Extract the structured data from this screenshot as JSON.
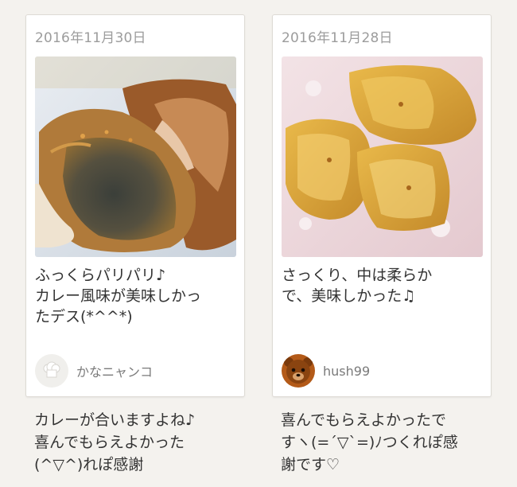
{
  "cards": [
    {
      "date": "2016年11月30日",
      "comment_lines": [
        "ふっくらパリパリ♪",
        "カレー風味が美味しかっ",
        "たデス(*^^*)"
      ],
      "user": {
        "name": "かなニャンコ",
        "avatar": "default-chef-hat-icon"
      },
      "reply_lines": [
        "カレーが合いますよね♪",
        "喜んでもらえよかった",
        "(^▽^)れぽ感謝"
      ]
    },
    {
      "date": "2016年11月28日",
      "comment_lines": [
        "さっくり、中は柔らか",
        "で、美味しかった♫"
      ],
      "user": {
        "name": "hush99",
        "avatar": "bear-avatar-icon"
      },
      "reply_lines": [
        "喜んでもらえよかったで",
        "すヽ(=´▽`=)ﾉつくれぽ感",
        "謝です♡"
      ]
    }
  ]
}
